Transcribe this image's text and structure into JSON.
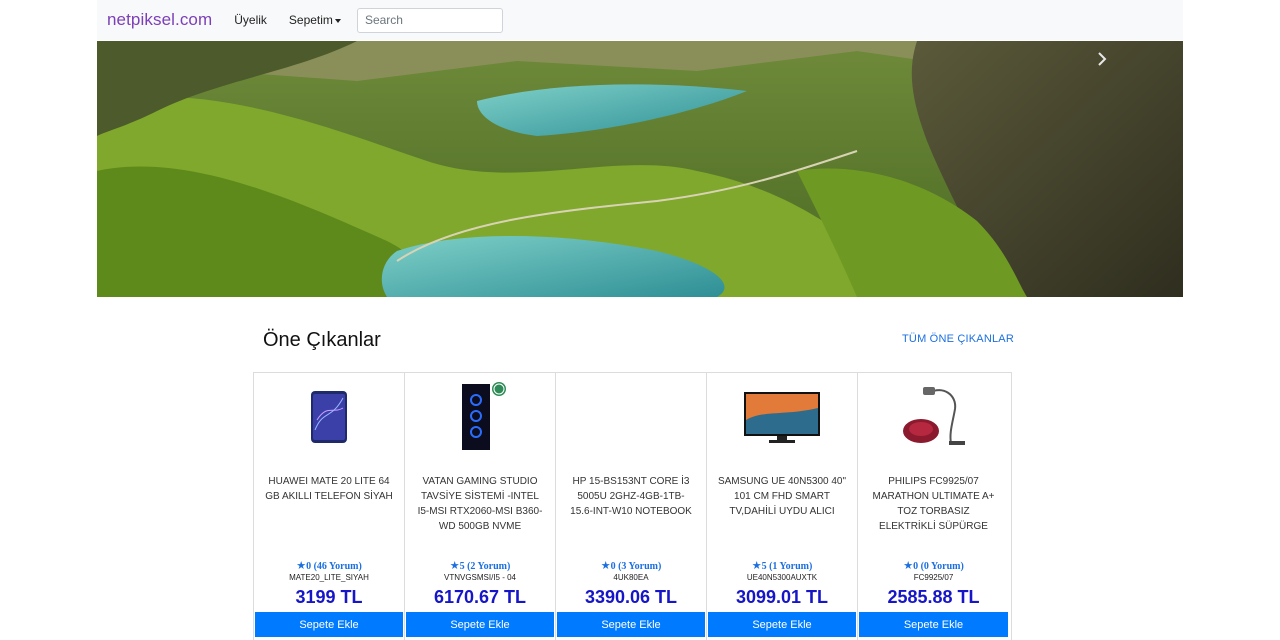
{
  "navbar": {
    "brand": "netpiksel.com",
    "links": [
      "Üyelik",
      "Sepetim"
    ],
    "search_placeholder": "Search"
  },
  "hero": {
    "next_icon": "chevron-right-icon"
  },
  "featured": {
    "title": "Öne Çıkanlar",
    "all_link": "TÜM ÖNE ÇIKANLAR"
  },
  "products": [
    {
      "name": "HUAWEI MATE 20 LITE 64 GB AKILLI TELEFON SİYAH",
      "rating": "0 (46 Yorum)",
      "sku": "MATE20_LITE_SIYAH",
      "price": "3199 TL",
      "button": "Sepete Ekle",
      "icon": "phone-icon"
    },
    {
      "name": "VATAN GAMING STUDIO TAVSİYE SİSTEMİ -INTEL I5-MSI RTX2060-MSI B360-WD 500GB NVME",
      "rating": "5 (2 Yorum)",
      "sku": "VTNVGSMSI/I5 - 04",
      "price": "6170.67 TL",
      "button": "Sepete Ekle",
      "icon": "pc-case-icon"
    },
    {
      "name": "HP 15-BS153NT CORE İ3 5005U 2GHZ-4GB-1TB-15.6-INT-W10 NOTEBOOK",
      "rating": "0 (3 Yorum)",
      "sku": "4UK80EA",
      "price": "3390.06 TL",
      "button": "Sepete Ekle",
      "icon": ""
    },
    {
      "name": "SAMSUNG UE 40N5300 40\" 101 CM FHD SMART TV,DAHİLİ UYDU ALICI",
      "rating": "5 (1 Yorum)",
      "sku": "UE40N5300AUXTK",
      "price": "3099.01 TL",
      "button": "Sepete Ekle",
      "icon": "tv-icon"
    },
    {
      "name": "PHILIPS FC9925/07 MARATHON ULTIMATE A+ TOZ TORBASIZ ELEKTRİKLİ SÜPÜRGE",
      "rating": "0 (0 Yorum)",
      "sku": "FC9925/07",
      "price": "2585.88 TL",
      "button": "Sepete Ekle",
      "icon": "vacuum-icon"
    }
  ],
  "colors": {
    "brand": "#7b3fb8",
    "link": "#1c6fe0",
    "button": "#007bff",
    "price": "#1616c8"
  }
}
